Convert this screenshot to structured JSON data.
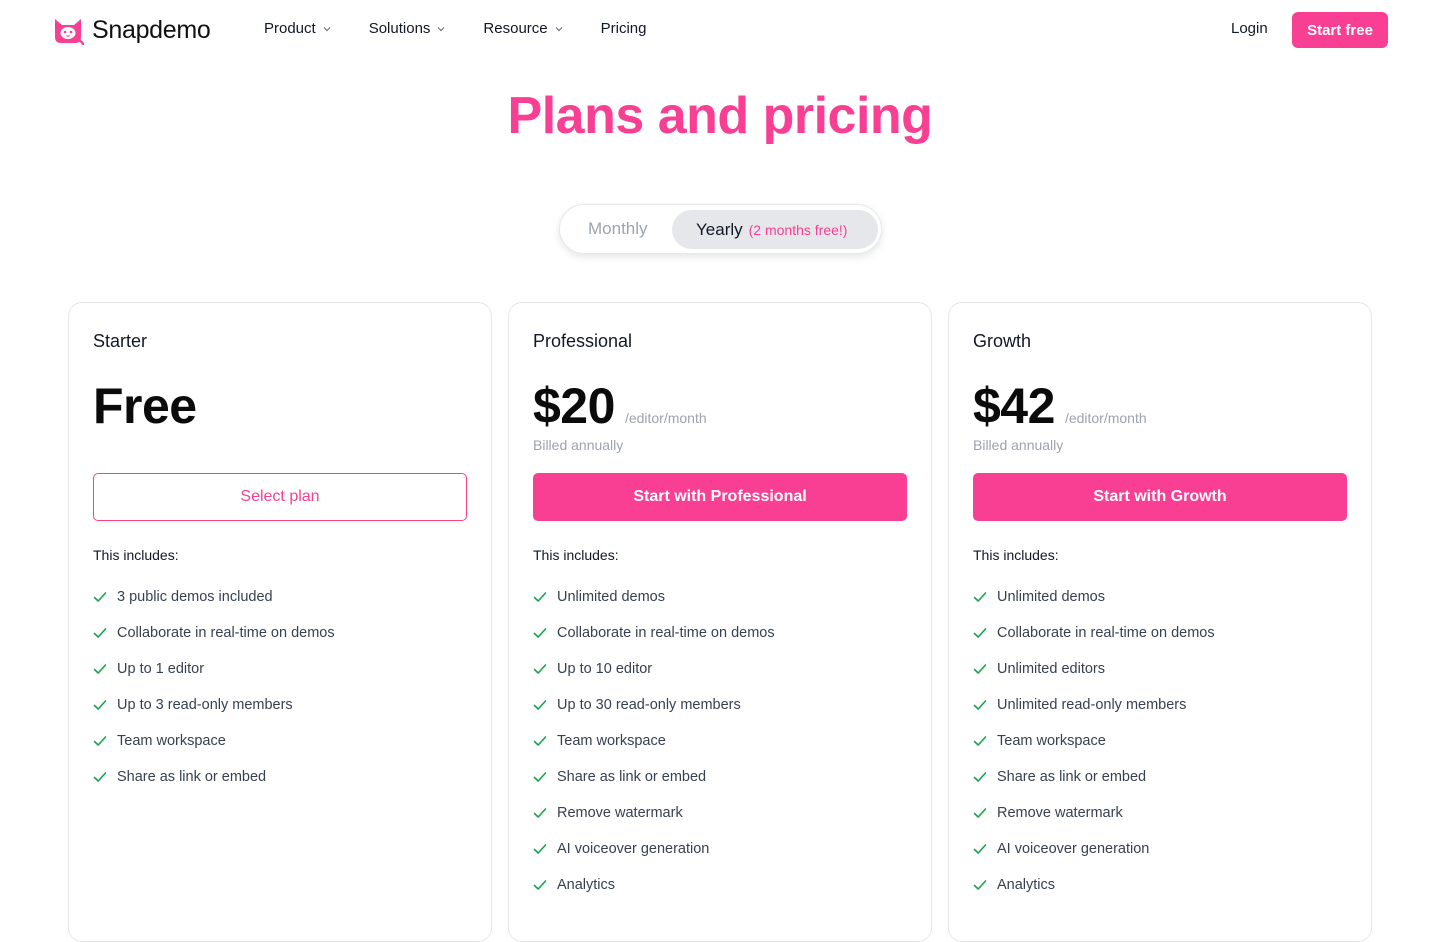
{
  "nav": {
    "brand": "Snapdemo",
    "menu": [
      {
        "label": "Product"
      },
      {
        "label": "Solutions"
      },
      {
        "label": "Resource"
      },
      {
        "label": "Pricing"
      }
    ],
    "login_label": "Login",
    "start_free_label": "Start free"
  },
  "page": {
    "title": "Plans and pricing"
  },
  "billing_toggle": {
    "monthly_label": "Monthly",
    "yearly_label": "Yearly",
    "yearly_promo": "(2 months free!)",
    "selected": "Yearly"
  },
  "plans": [
    {
      "name": "Starter",
      "price": "Free",
      "per": "",
      "billed": "",
      "cta": "Select plan",
      "includes_label": "This includes:",
      "features": [
        "3 public demos included",
        "Collaborate in real-time on demos",
        "Up to 1 editor",
        "Up to 3 read-only members",
        "Team workspace",
        "Share as link or embed"
      ]
    },
    {
      "name": "Professional",
      "price": "$20",
      "per": "/editor/month",
      "billed": "Billed annually",
      "cta": "Start with Professional",
      "includes_label": "This includes:",
      "features": [
        "Unlimited demos",
        "Collaborate in real-time on demos",
        "Up to 10 editor",
        "Up to 30 read-only members",
        "Team workspace",
        "Share as link or embed",
        "Remove watermark",
        "AI voiceover generation",
        "Analytics"
      ]
    },
    {
      "name": "Growth",
      "price": "$42",
      "per": "/editor/month",
      "billed": "Billed annually",
      "cta": "Start with Growth",
      "includes_label": "This includes:",
      "features": [
        "Unlimited demos",
        "Collaborate in real-time on demos",
        "Unlimited editors",
        "Unlimited read-only members",
        "Team workspace",
        "Share as link or embed",
        "Remove watermark",
        "AI voiceover generation",
        "Analytics"
      ]
    }
  ],
  "colors": {
    "accent": "#f83f93",
    "check": "#16a34a",
    "muted": "#9ca3af",
    "border": "#e5e7eb"
  },
  "icons": {
    "logo": "cat-face-logo-icon",
    "dropdown": "chevron-down-icon",
    "feature": "check-icon"
  }
}
